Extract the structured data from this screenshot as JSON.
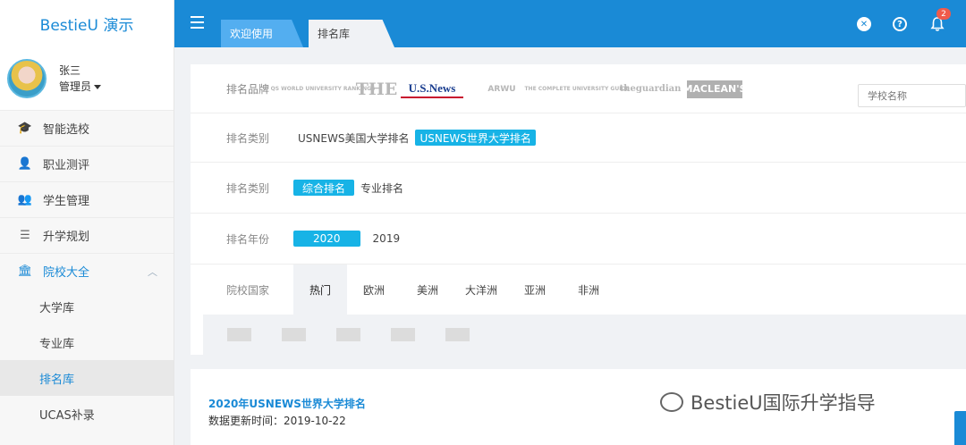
{
  "brand": "BestieU 演示",
  "user": {
    "name": "张三",
    "role": "管理员"
  },
  "sidebar": {
    "items": [
      {
        "label": "智能选校",
        "icon": "graduation-cap-icon"
      },
      {
        "label": "职业测评",
        "icon": "person-icon"
      },
      {
        "label": "学生管理",
        "icon": "users-icon"
      },
      {
        "label": "升学规划",
        "icon": "list-icon"
      },
      {
        "label": "院校大全",
        "icon": "institution-icon"
      }
    ],
    "sub_items": [
      "大学库",
      "专业库",
      "排名库",
      "UCAS补录"
    ]
  },
  "tabs": [
    "欢迎使用",
    "排名库"
  ],
  "notifications": {
    "count": "2"
  },
  "filters": {
    "brand_label": "排名品牌",
    "brand_logos": [
      "QS WORLD UNIVERSITY RANKINGS",
      "THE",
      "U.S.News",
      "ARWU",
      "THE COMPLETE UNIVERSITY GUIDE",
      "theguardian",
      "MACLEAN'S"
    ],
    "search_placeholder": "学校名称",
    "type_label": "排名类别",
    "type_options": [
      "USNEWS美国大学排名",
      "USNEWS世界大学排名"
    ],
    "category_label": "排名类别",
    "category_options": [
      "综合排名",
      "专业排名"
    ],
    "year_label": "排名年份",
    "year_options": [
      "2020",
      "2019"
    ],
    "country_label": "院校国家",
    "regions": [
      "热门",
      "欧洲",
      "美洲",
      "大洋洲",
      "亚洲",
      "非洲"
    ]
  },
  "result": {
    "title": "2020年USNEWS世界大学排名",
    "update_time": "数据更新时间：2019-10-22"
  },
  "watermark": "BestieU国际升学指导"
}
